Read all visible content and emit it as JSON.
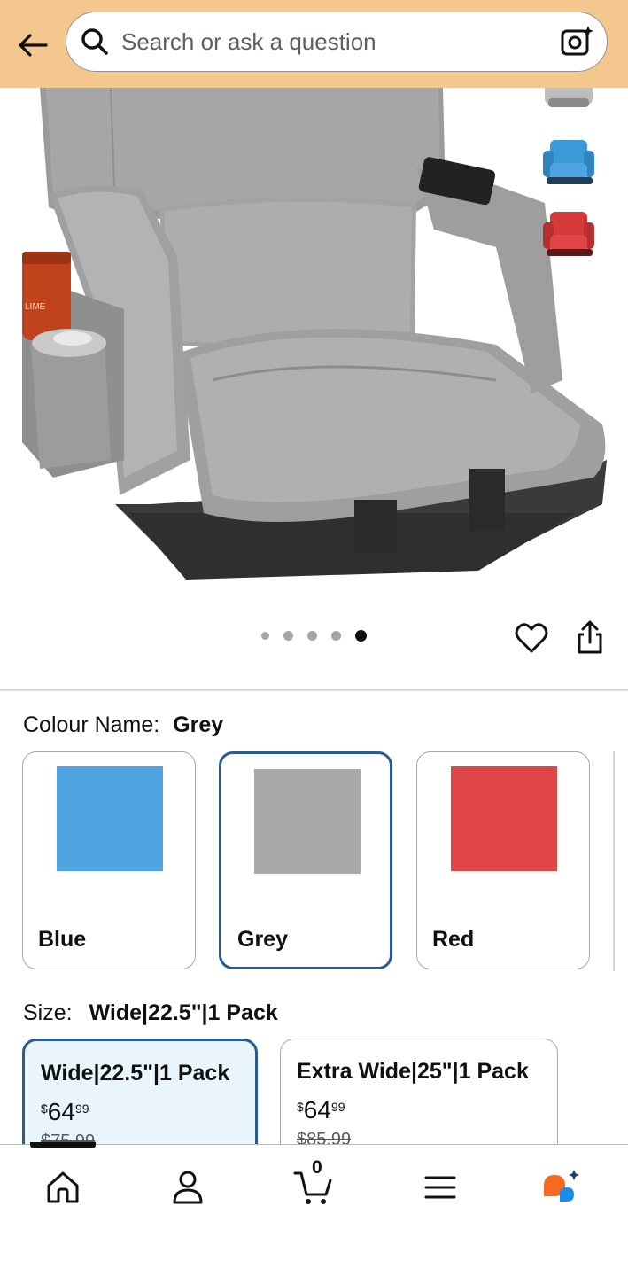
{
  "header": {
    "search_placeholder": "Search or ask a question"
  },
  "gallery": {
    "image_count": 5,
    "active_index": 4,
    "thumbnails": [
      "grey-chair",
      "blue-chair",
      "red-chair"
    ],
    "can_label_text": "LIME"
  },
  "colour": {
    "label": "Colour Name:",
    "selected": "Grey",
    "options": [
      {
        "name": "Blue",
        "color": "#4ea4e0"
      },
      {
        "name": "Grey",
        "color": "#a9a9a9"
      },
      {
        "name": "Red",
        "color": "#e04545"
      }
    ]
  },
  "size": {
    "label": "Size:",
    "selected": "Wide|22.5\"|1 Pack",
    "options": [
      {
        "title": "Wide|22.5\"|1 Pack",
        "currency": "$",
        "whole": "64",
        "fraction": "99",
        "was": "$75.99"
      },
      {
        "title": "Extra Wide|25\"|1 Pack",
        "currency": "$",
        "whole": "64",
        "fraction": "99",
        "was": "$85.99"
      }
    ]
  },
  "nav": {
    "cart_count": "0",
    "items": [
      "home-icon",
      "account-icon",
      "cart-icon",
      "menu-icon",
      "rufus-icon"
    ]
  },
  "colors": {
    "header_bg": "#f4c78e",
    "selected_border": "#2a5c91",
    "selected_bg": "#eaf4fb"
  }
}
